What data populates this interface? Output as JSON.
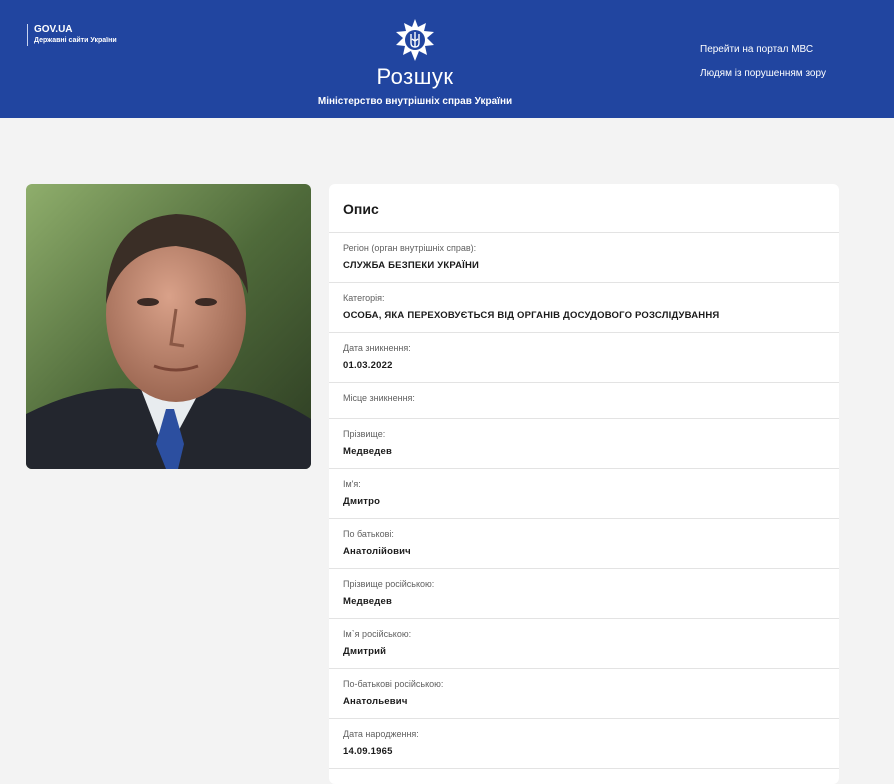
{
  "header": {
    "gov_title": "GOV.UA",
    "gov_subtitle": "Державні сайти України",
    "site_title": "Розшук",
    "site_subtitle": "Міністерство внутрішніх справ України",
    "links": [
      "Перейти на портал МВС",
      "Людям із порушенням зору"
    ],
    "bg_color": "#2145a0"
  },
  "card": {
    "title": "Опис",
    "fields": [
      {
        "label": "Регіон (орган внутрішніх справ):",
        "value": "СЛУЖБА БЕЗПЕКИ УКРАЇНИ"
      },
      {
        "label": "Категорія:",
        "value": "ОСОБА, ЯКА ПЕРЕХОВУЄТЬСЯ ВІД ОРГАНІВ ДОСУДОВОГО РОЗСЛІДУВАННЯ"
      },
      {
        "label": "Дата зникнення:",
        "value": "01.03.2022"
      },
      {
        "label": "Місце зникнення:",
        "value": ""
      },
      {
        "label": "Прізвище:",
        "value": "Медведев"
      },
      {
        "label": "Ім'я:",
        "value": "Дмитро"
      },
      {
        "label": "По батькові:",
        "value": "Анатолійович"
      },
      {
        "label": "Прізвище російською:",
        "value": "Медведев"
      },
      {
        "label": "Ім`я російською:",
        "value": "Дмитрий"
      },
      {
        "label": "По-батькові російською:",
        "value": "Анатольевич"
      },
      {
        "label": "Дата народження:",
        "value": "14.09.1965"
      }
    ]
  }
}
